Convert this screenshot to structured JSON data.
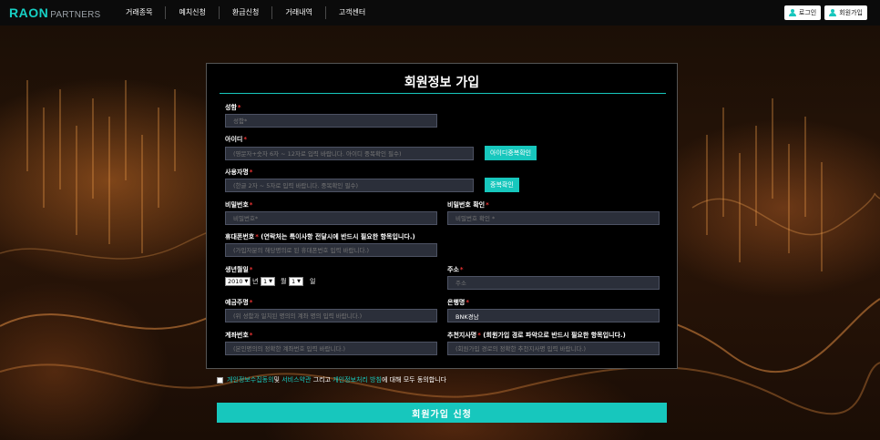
{
  "brand": {
    "main": "RAON",
    "sub": "PARTNERS"
  },
  "nav": [
    "거래종목",
    "예치신청",
    "환급신청",
    "거래내역",
    "고객센터"
  ],
  "auth": {
    "login": "로그인",
    "signup": "회원가입"
  },
  "form": {
    "title": "회원정보 가입",
    "fields": {
      "name": {
        "label": "성함",
        "placeholder": "성함*"
      },
      "userid": {
        "label": "아이디",
        "placeholder": "(영문자+숫자 6자 ~ 12자로 입력 바랍니다. 아이디 중복확인 필수)",
        "button": "아이디중복확인"
      },
      "username": {
        "label": "사용자명",
        "placeholder": "(한글 2자 ~ 5자로 입력 바랍니다. 중복확인 필수)",
        "button": "중복확인"
      },
      "password": {
        "label": "비밀번호",
        "placeholder": "비밀번호*"
      },
      "password_confirm": {
        "label": "비밀번호 확인",
        "placeholder": "비밀번호 확인 *"
      },
      "phone": {
        "label": "휴대폰번호",
        "note": " (연락처는 특이사항 전달시에 반드시 필요한 항목입니다.)",
        "placeholder": "(가입자분의 해당명의로 된 휴대폰번호 입력 바랍니다.)"
      },
      "birth": {
        "label": "생년월일",
        "year": "2010",
        "year_unit": "년",
        "month": "1",
        "month_unit": "월",
        "day": "1",
        "day_unit": "일"
      },
      "address": {
        "label": "주소",
        "placeholder": "주소"
      },
      "depositor": {
        "label": "예금주명",
        "placeholder": "(위 성함과 일치된 명의의 계좌 명의 입력 바랍니다.)"
      },
      "bank": {
        "label": "은행명",
        "value": "BNK경남"
      },
      "account": {
        "label": "계좌번호",
        "placeholder": "(본인명의의 정확한 계좌번호 입력 바랍니다.)"
      },
      "referrer": {
        "label": "추천지사명",
        "note": " (회원가입 경로 파악으로 반드시 필요한 항목입니다.)",
        "placeholder": "(회원가입 경로의 정확한 추천지사명 입력 바랍니다.)"
      }
    },
    "required_mark": "*",
    "agreement": {
      "link1": "개인정보수집동의",
      "text1": "및 ",
      "link2": "서비스약관",
      "text2": " 그리고 ",
      "link3": "개인정보처리 방침",
      "text3": "에 대해 모두 동의합니다"
    },
    "submit": "회원가입 신청"
  }
}
